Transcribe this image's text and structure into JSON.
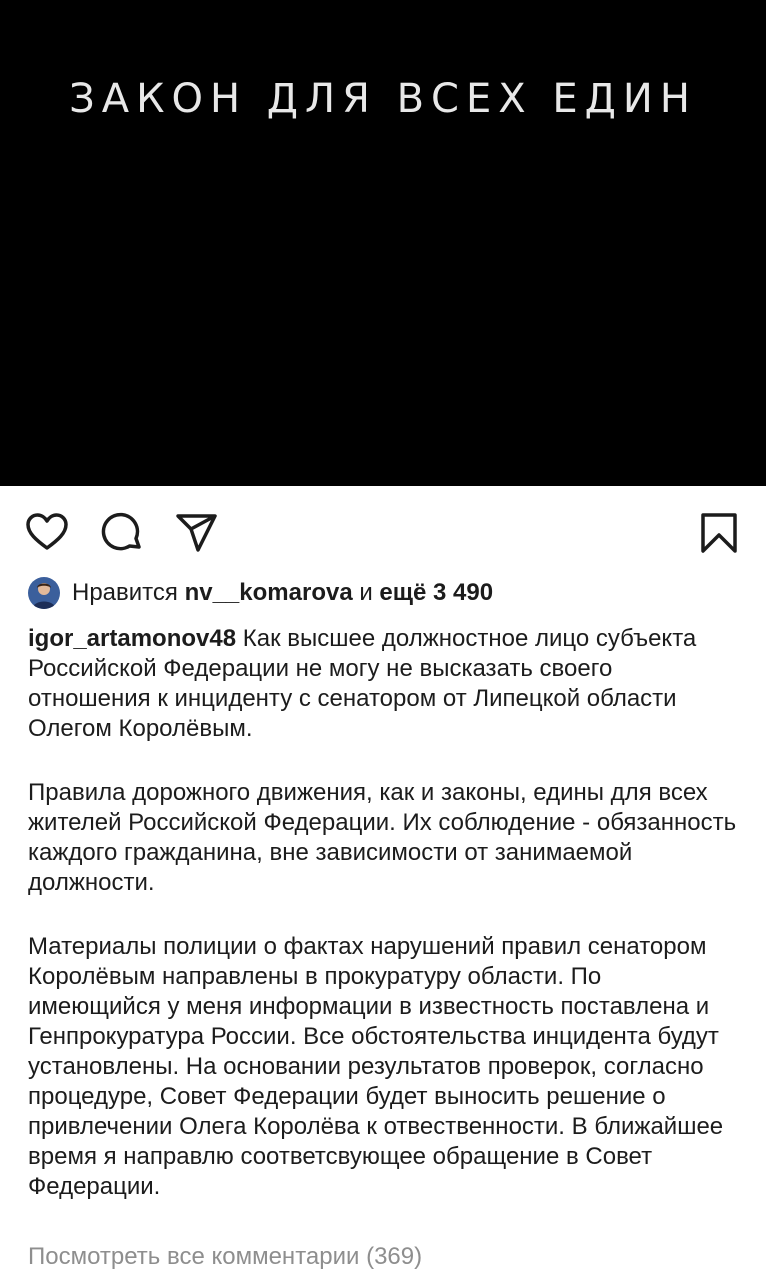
{
  "post": {
    "image_text": "ЗАКОН ДЛЯ ВСЕХ ЕДИН",
    "image_bg": "#000000"
  },
  "actions": {
    "like_icon": "heart-icon",
    "comment_icon": "comment-icon",
    "share_icon": "send-icon",
    "save_icon": "bookmark-icon"
  },
  "likes": {
    "prefix": "Нравится",
    "user": "nv__komarova",
    "connector": "и",
    "more": "ещё 3 490"
  },
  "caption": {
    "username": "igor_artamonov48",
    "paragraph1": "Как высшее должностное лицо субъекта Российской Федерации не могу не высказать своего отношения к инциденту с сенатором от Липецкой области Олегом Королёвым.",
    "paragraph2": "Правила дорожного движения, как и законы, едины для всех жителей Российской Федерации. Их соблюдение - обязанность каждого гражданина, вне зависимости от занимаемой должности.",
    "paragraph3": "Материалы полиции о фактах нарушений правил сенатором Королёвым направлены в прокуратуру области. По имеющийся у меня информации в известность поставлена и Генпрокуратура России.  Все обстоятельства инцидента будут установлены. На основании результатов проверок, согласно процедуре, Совет Федерации будет выносить решение о привлечении Олега Королёва к отвественности. В ближайшее время я направлю соответсвующее обращение в Совет Федерации."
  },
  "comments": {
    "view_all": "Посмотреть все комментарии (369)"
  },
  "colors": {
    "text": "#1c1c1c",
    "muted": "#8e8e8e"
  }
}
